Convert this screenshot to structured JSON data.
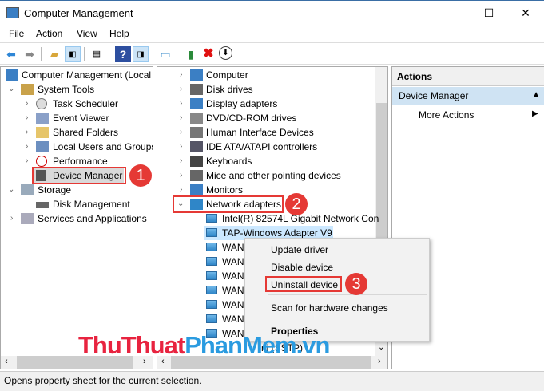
{
  "window": {
    "title": "Computer Management",
    "minimize": "—",
    "maximize": "☐",
    "close": "✕"
  },
  "menu": [
    "File",
    "Action",
    "View",
    "Help"
  ],
  "left_tree": {
    "root": "Computer Management (Local",
    "system_tools": "System Tools",
    "items": [
      "Task Scheduler",
      "Event Viewer",
      "Shared Folders",
      "Local Users and Groups",
      "Performance",
      "Device Manager"
    ],
    "storage": "Storage",
    "disk": "Disk Management",
    "services": "Services and Applications"
  },
  "device_tree": {
    "items": [
      "Computer",
      "Disk drives",
      "Display adapters",
      "DVD/CD-ROM drives",
      "Human Interface Devices",
      "IDE ATA/ATAPI controllers",
      "Keyboards",
      "Mice and other pointing devices",
      "Monitors",
      "Network adapters"
    ],
    "network_children": [
      "Intel(R) 82574L Gigabit Network Con",
      "TAP-Windows Adapter V9",
      "WAN",
      "WAN",
      "WAN",
      "WAN",
      "WAN",
      "WAN",
      "WAN"
    ],
    "last_row": "ni (SSTP)"
  },
  "context_menu": [
    "Update driver",
    "Disable device",
    "Uninstall device",
    "Scan for hardware changes",
    "Properties"
  ],
  "actions": {
    "header": "Actions",
    "section": "Device Manager",
    "more": "More Actions"
  },
  "steps": [
    "1",
    "2",
    "3"
  ],
  "status": "Opens property sheet for the current selection.",
  "watermark": {
    "red": "ThuThuat",
    "blue": "PhanMem.vn"
  },
  "colors": {
    "accent": "#e53935",
    "selection": "#cce8ff"
  }
}
